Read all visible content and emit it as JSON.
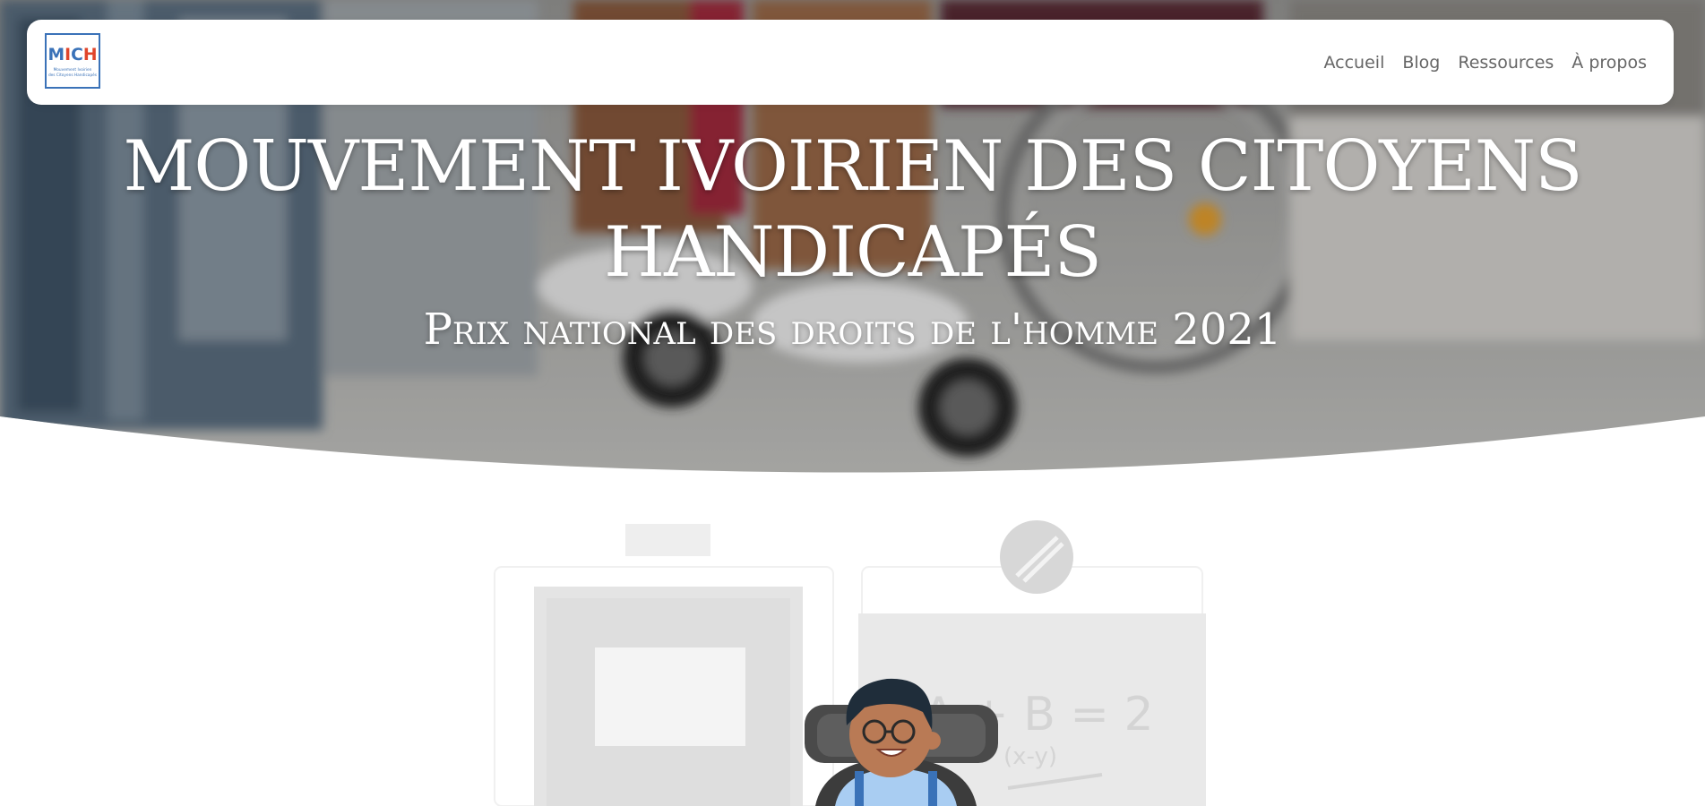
{
  "logo": {
    "text": "MICH",
    "tagline": "Mouvement Ivoirien des Citoyens Handicapés"
  },
  "nav": {
    "items": [
      {
        "label": "Accueil"
      },
      {
        "label": "Blog"
      },
      {
        "label": "Ressources"
      },
      {
        "label": "À propos"
      }
    ]
  },
  "hero": {
    "title": "MOUVEMENT IVOIRIEN DES CITOYENS HANDICAPÉS",
    "subtitle": "Prix national des droits de l'homme 2021"
  },
  "illustration": {
    "board_text_1": "A + B = 2",
    "board_text_2": "(x-y)"
  },
  "colors": {
    "nav_text": "#666666",
    "hero_text": "#ffffff",
    "logo_blue": "#3a72b8",
    "logo_red": "#e0452b"
  }
}
